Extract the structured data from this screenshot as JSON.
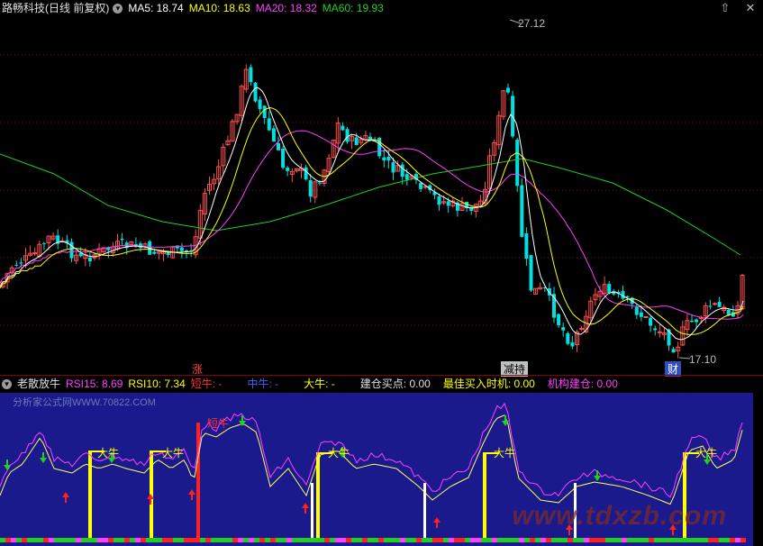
{
  "header": {
    "title": "路畅科技(日线 前复权)",
    "ma5": "MA5: 18.74",
    "ma10": "MA10: 18.63",
    "ma20": "MA20: 18.32",
    "ma60": "MA60: 19.93"
  },
  "price_chart": {
    "high_label": "27.12",
    "low_label": "17.10",
    "event_labels": [
      "涨",
      "减持",
      "财"
    ]
  },
  "indicator_header": {
    "name": "老散放牛",
    "rsi15": "RSI15: 8.69",
    "rsi10": "RSI10: 7.34",
    "short_bull": "短牛: -",
    "mid_bull": "中牛: -",
    "big_bull": "大牛: -",
    "build_buy": "建仓买点: 0.00",
    "best_buy": "最佳买入时机: 0.00",
    "inst_build": "机构建仓: 0.00"
  },
  "indicator_chart": {
    "bull_labels": [
      "大牛",
      "大牛",
      "短牛",
      "大牛",
      "大牛",
      "大牛"
    ],
    "watermark": "分析家公式网WWW.70822.COM",
    "watermark2": "www.tdxzb.com"
  },
  "colors": {
    "up": "#ff5050",
    "down": "#00e0e0",
    "ma5": "#ffffff",
    "ma10": "#ffff00",
    "ma20": "#ff40ff",
    "ma60": "#20d020",
    "panel_bg": "#1a1a8c"
  },
  "icons": [
    "chevron-down-icon",
    "up-arrow-icon",
    "close-icon"
  ]
}
